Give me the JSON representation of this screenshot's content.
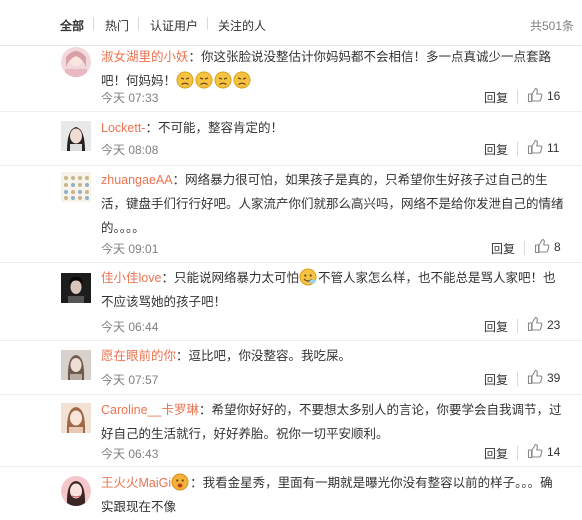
{
  "tabs": {
    "all": "全部",
    "hot": "热门",
    "verified": "认证用户",
    "following": "关注的人",
    "count": "共501条"
  },
  "comments": [
    {
      "user": "淑女湖里的小妖",
      "text": "：你这张脸说没整估计你妈妈都不会相信！多一点真诚少一点套路吧！何妈妈！",
      "time": "今天 07:33",
      "reply": "回复",
      "likes": "16"
    },
    {
      "user": "Lockett-",
      "text": "：不可能，整容肯定的！",
      "time": "今天 08:08",
      "reply": "回复",
      "likes": "11"
    },
    {
      "user": "zhuangaeAA",
      "text": "：网络暴力很可怕，如果孩子是真的，只希望你生好孩子过自己的生活，键盘手们行行好吧。人家流产你们就那么高兴吗，网络不是给你发泄自己的情绪的。。。。",
      "time": "今天 09:01",
      "reply": "回复",
      "likes": "8"
    },
    {
      "user": "佳小佳love",
      "text_a": "：只能说网络暴力太可怕",
      "text_b": "不管人家怎么样，也不能总是骂人家吧！也不应该骂她的孩子吧！",
      "time": "今天 06:44",
      "reply": "回复",
      "likes": "23"
    },
    {
      "user": "愿在眼前的你",
      "text": "：逗比吧，你没整容。我吃屎。",
      "time": "今天 07:57",
      "reply": "回复",
      "likes": "39"
    },
    {
      "user": "Caroline__卡罗琳",
      "text": "：希望你好好的，不要想太多别人的言论，你要学会自我调节，过好自己的生活就行，好好养胎。祝你一切平安顺利。",
      "time": "今天 06:43",
      "reply": "回复",
      "likes": "14"
    },
    {
      "user": "王火火MaiGi",
      "text": "：我看金星秀，里面有一期就是曝光你没有整容以前的样子。。。确实跟现在不像"
    }
  ],
  "colors": {
    "username": "#eb7350",
    "meta": "#808080",
    "divider": "#ececec"
  }
}
